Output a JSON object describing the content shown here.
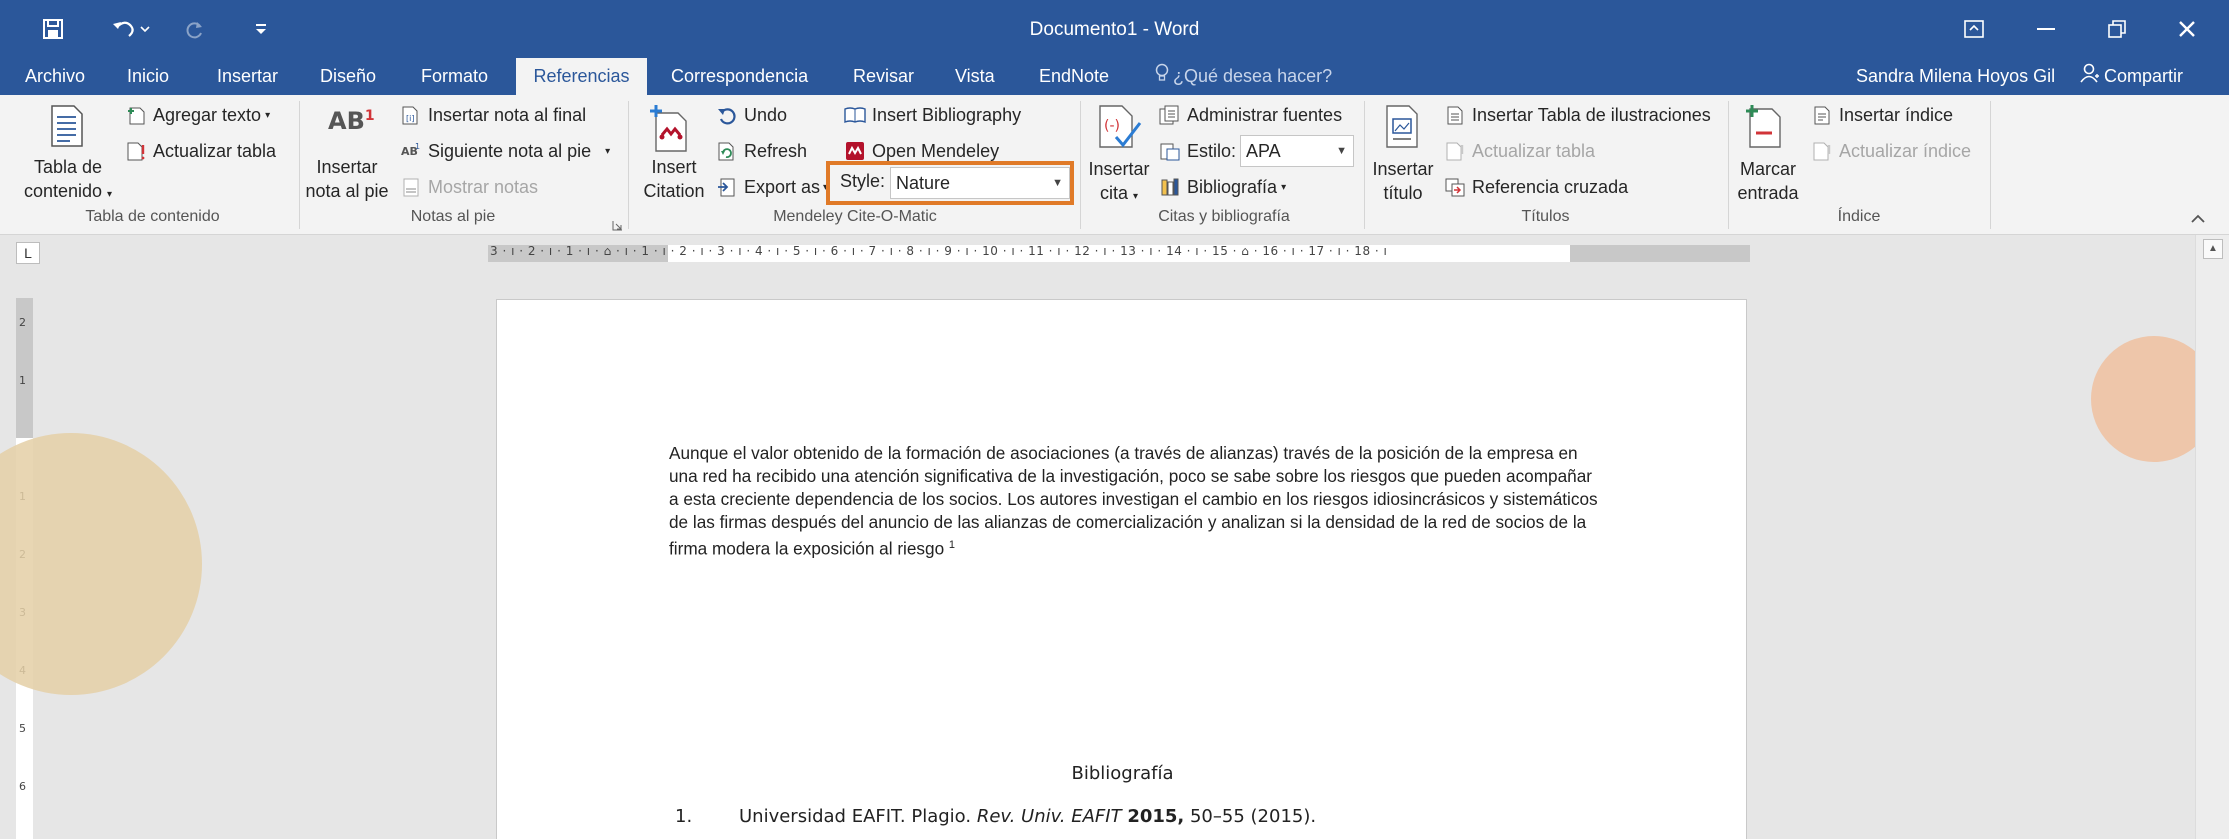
{
  "window": {
    "title": "Documento1 - Word"
  },
  "tabs": {
    "archivo": "Archivo",
    "inicio": "Inicio",
    "insertar": "Insertar",
    "diseno": "Diseño",
    "formato": "Formato",
    "referencias": "Referencias",
    "correspondencia": "Correspondencia",
    "revisar": "Revisar",
    "vista": "Vista",
    "endnote": "EndNote",
    "tell_me": "¿Qué desea hacer?",
    "user": "Sandra Milena Hoyos Gil",
    "share": "Compartir"
  },
  "ribbon": {
    "toc": {
      "tabla_line1": "Tabla de",
      "tabla_line2": "contenido",
      "agregar_texto": "Agregar texto",
      "actualizar_tabla": "Actualizar tabla",
      "group": "Tabla de contenido"
    },
    "footnotes": {
      "insertar_line1": "Insertar",
      "insertar_line2": "nota al pie",
      "insertar_final": "Insertar nota al final",
      "siguiente": "Siguiente nota al pie",
      "mostrar": "Mostrar notas",
      "group": "Notas al pie"
    },
    "mendeley": {
      "insert_line1": "Insert",
      "insert_line2": "Citation",
      "undo": "Undo",
      "refresh": "Refresh",
      "export": "Export as",
      "insert_bibliography": "Insert Bibliography",
      "open_mendeley": "Open Mendeley",
      "style_label": "Style:",
      "style_value": "Nature",
      "group": "Mendeley Cite-O-Matic"
    },
    "citas": {
      "insertar_line1": "Insertar",
      "insertar_line2": "cita",
      "administrar": "Administrar fuentes",
      "estilo_label": "Estilo:",
      "estilo_value": "APA",
      "bibliografia": "Bibliografía",
      "group": "Citas y bibliografía"
    },
    "titulos": {
      "insertar_line1": "Insertar",
      "insertar_line2": "título",
      "tabla_ilustraciones": "Insertar Tabla de ilustraciones",
      "actualizar_tabla": "Actualizar tabla",
      "referencia_cruzada": "Referencia cruzada",
      "group": "Títulos"
    },
    "indice": {
      "marcar_line1": "Marcar",
      "marcar_line2": "entrada",
      "insertar_indice": "Insertar índice",
      "actualizar_indice": "Actualizar índice",
      "group": "Índice"
    }
  },
  "ruler": {
    "horizontal_scale": "3 · ı · 2 · ı · 1 · ı · ⌂ · ı · 1 · ı · 2 · ı · 3 · ı · 4 · ı · 5 · ı · 6 · ı · 7 · ı · 8 · ı · 9 · ı · 10 · ı · 11 · ı · 12 · ı · 13 · ı · 14 · ı · 15 · ⌂ · 16 · ı · 17 · ı · 18 · ı",
    "vertical_marks": [
      "2",
      "1",
      "1",
      "2",
      "3",
      "4",
      "5",
      "6"
    ]
  },
  "document": {
    "paragraph": "Aunque el valor obtenido de la formación de asociaciones (a través de alianzas) través de la posición de la empresa en una red ha recibido una atención significativa de la investigación, poco se sabe sobre los riesgos que pueden acompañar a esta creciente dependencia de los socios. Los autores investigan el cambio en los riesgos idiosincrásicos y sistemáticos de las firmas después del anuncio de las alianzas de comercialización y analizan si la densidad de la red de socios de la firma modera la exposición al riesgo",
    "footnote_marker": "1",
    "bibliography_title": "Bibliografía",
    "bibliography": [
      {
        "number": "1.",
        "authors": "Universidad EAFIT. Plagio.",
        "journal": "Rev. Univ. EAFIT",
        "year": "2015,",
        "rest": "50–55 (2015)."
      }
    ]
  },
  "colors": {
    "accent": "#2b579a",
    "highlight_box": "#e07a28",
    "deco_left": "#e4cfa6",
    "deco_right": "#eebf9f"
  }
}
